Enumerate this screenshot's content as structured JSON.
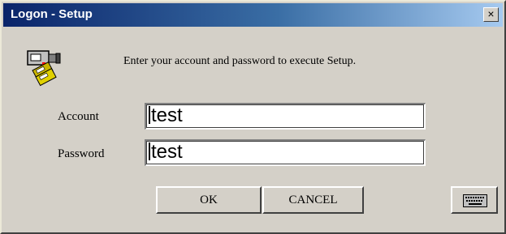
{
  "window": {
    "title": "Logon - Setup",
    "close_glyph": "×"
  },
  "message": "Enter your account and password to execute Setup.",
  "fields": {
    "account_label": "Account",
    "account_value": "test",
    "password_label": "Password",
    "password_value": "test"
  },
  "buttons": {
    "ok_label": "OK",
    "cancel_label": "CANCEL",
    "keyboard_icon": "keyboard-icon"
  },
  "icons": {
    "setup": "setup-icon",
    "close": "close-icon"
  },
  "colors": {
    "titlebar_start": "#0a246a",
    "titlebar_end": "#a6caf0",
    "dialog_face": "#d4d0c8"
  }
}
